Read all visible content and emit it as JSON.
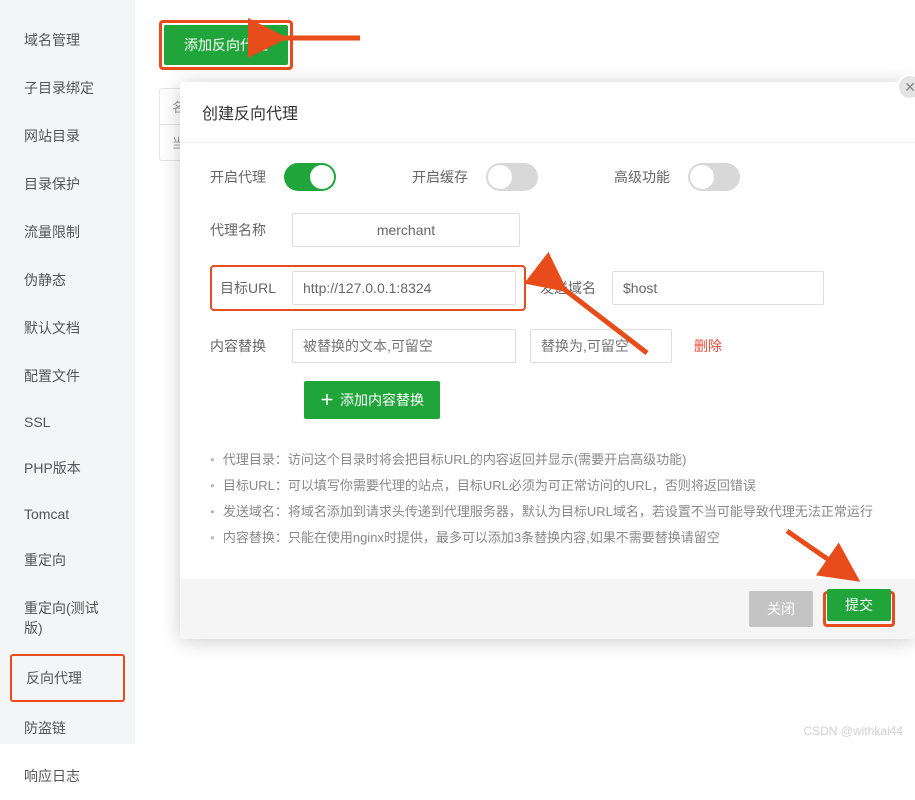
{
  "sidebar": {
    "items": [
      {
        "label": "域名管理"
      },
      {
        "label": "子目录绑定"
      },
      {
        "label": "网站目录"
      },
      {
        "label": "目录保护"
      },
      {
        "label": "流量限制"
      },
      {
        "label": "伪静态"
      },
      {
        "label": "默认文档"
      },
      {
        "label": "配置文件"
      },
      {
        "label": "SSL"
      },
      {
        "label": "PHP版本"
      },
      {
        "label": "Tomcat"
      },
      {
        "label": "重定向"
      },
      {
        "label": "重定向(测试版)"
      },
      {
        "label": "反向代理"
      },
      {
        "label": "防盗链"
      },
      {
        "label": "响应日志"
      }
    ],
    "active_index": 13
  },
  "main": {
    "add_button": "添加反向代理",
    "table_headers": {
      "name": "名",
      "current": "当"
    }
  },
  "modal": {
    "title": "创建反向代理",
    "toggles": {
      "proxy": {
        "label": "开启代理",
        "on": true
      },
      "cache": {
        "label": "开启缓存",
        "on": false
      },
      "advanced": {
        "label": "高级功能",
        "on": false
      }
    },
    "fields": {
      "proxy_name": {
        "label": "代理名称",
        "value": "merchant"
      },
      "target_url": {
        "label": "目标URL",
        "value": "http://127.0.0.1:8324"
      },
      "send_domain": {
        "label": "发送域名",
        "value": "$host"
      },
      "content_replace": {
        "label": "内容替换",
        "placeholder1": "被替换的文本,可留空",
        "placeholder2": "替换为,可留空"
      }
    },
    "delete_label": "删除",
    "add_content_label": "添加内容替换",
    "hints": [
      "代理目录：访问这个目录时将会把目标URL的内容返回并显示(需要开启高级功能)",
      "目标URL：可以填写你需要代理的站点，目标URL必须为可正常访问的URL，否则将返回错误",
      "发送域名：将域名添加到请求头传递到代理服务器，默认为目标URL域名，若设置不当可能导致代理无法正常运行",
      "内容替换：只能在使用nginx时提供，最多可以添加3条替换内容,如果不需要替换请留空"
    ],
    "footer": {
      "cancel": "关闭",
      "submit": "提交"
    }
  },
  "watermark": "CSDN @withkai44"
}
